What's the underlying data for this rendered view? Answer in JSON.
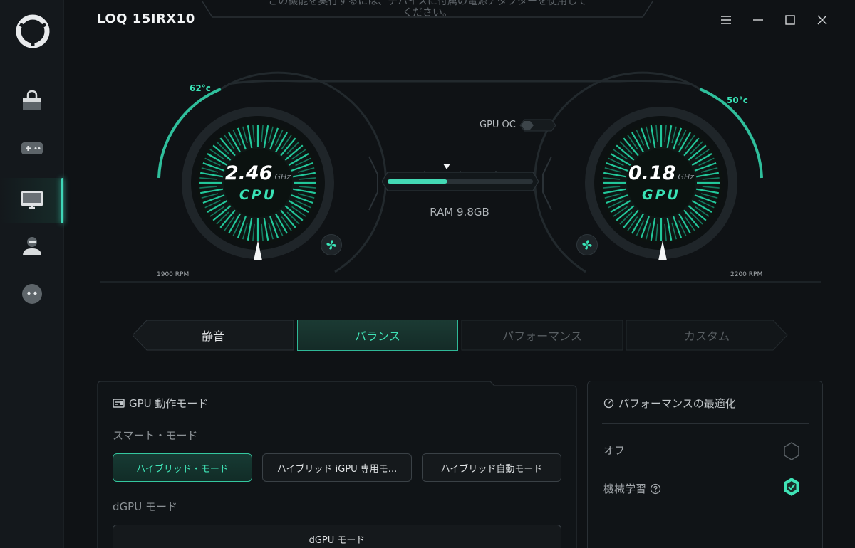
{
  "app": {
    "title": "LOQ 15IRX10",
    "banner_line1": "この機能を実行するには、デバイスに付属の電源アダプターを使用して",
    "banner_line2": "ください。"
  },
  "sidebar": {
    "items": [
      {
        "name": "store",
        "icon": "shopping-bag-icon"
      },
      {
        "name": "games",
        "icon": "gamepad-icon"
      },
      {
        "name": "device",
        "icon": "monitor-icon",
        "active": true
      },
      {
        "name": "account",
        "icon": "user-icon"
      },
      {
        "name": "assistant",
        "icon": "robot-face-icon"
      }
    ]
  },
  "cpu": {
    "freq": "2.46",
    "unit": "GHz",
    "label": "CPU",
    "temp": "62°c",
    "rpm": "1900 RPM"
  },
  "gpu": {
    "freq": "0.18",
    "unit": "GHz",
    "label": "GPU",
    "temp": "50°c",
    "rpm": "2200 RPM"
  },
  "center": {
    "gpu_oc_label": "GPU OC",
    "gpu_oc_on": false,
    "ram_text": "RAM 9.8GB",
    "ram_fill_fraction": 0.41
  },
  "modes": {
    "quiet": "静音",
    "balance": "バランス",
    "performance": "パフォーマンス",
    "custom": "カスタム",
    "selected": "balance"
  },
  "gpu_mode_panel": {
    "title": "GPU 動作モード",
    "smart_label": "スマート・モード",
    "hybrid": "ハイブリッド・モード",
    "hybrid_igpu": "ハイブリッド iGPU 専用モ...",
    "hybrid_auto": "ハイブリッド自動モード",
    "dgpu_label": "dGPU モード",
    "dgpu_button": "dGPU モード"
  },
  "perf_opt_panel": {
    "title": "パフォーマンスの最適化",
    "off": "オフ",
    "ml": "機械学習",
    "selected": "ml"
  },
  "colors": {
    "accent": "#3fe3b6",
    "background": "#0f1215",
    "sidebar": "#14181c"
  }
}
